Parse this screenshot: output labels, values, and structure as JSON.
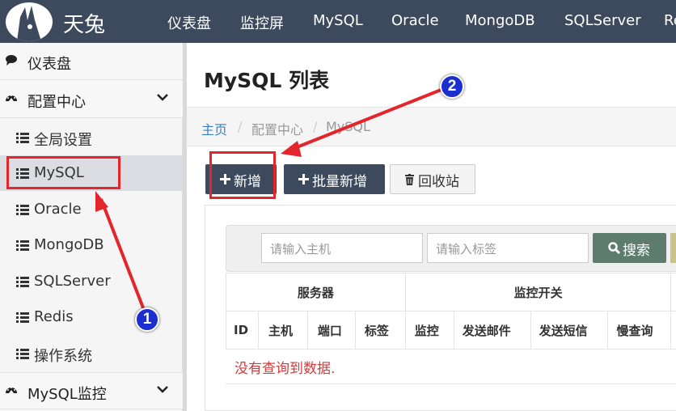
{
  "brand": {
    "name": "天兔"
  },
  "nav": [
    "仪表盘",
    "监控屏",
    "MySQL",
    "Oracle",
    "MongoDB",
    "SQLServer",
    "Re"
  ],
  "sidebar": {
    "dashboard": "仪表盘",
    "config_center": "配置中心",
    "items": [
      "全局设置",
      "MySQL",
      "Oracle",
      "MongoDB",
      "SQLServer",
      "Redis",
      "操作系统"
    ],
    "mysql_monitor": "MySQL监控",
    "active_item": "MySQL"
  },
  "page": {
    "title": "MySQL 列表"
  },
  "breadcrumb": {
    "home": "主页",
    "sep": "/",
    "section": "配置中心",
    "current": "MySQL"
  },
  "toolbar": {
    "add": "新增",
    "batch_add": "批量新增",
    "recycle": "回收站"
  },
  "search": {
    "host_placeholder": "请输入主机",
    "tag_placeholder": "请输入标签",
    "button": "搜索"
  },
  "table": {
    "group_headers": [
      "服务器",
      "监控开关"
    ],
    "columns": [
      "ID",
      "主机",
      "端口",
      "标签",
      "监控",
      "发送邮件",
      "发送短信",
      "慢查询"
    ],
    "empty_message": "没有查询到数据."
  },
  "annotations": {
    "badge_1": "1",
    "badge_2": "2"
  },
  "colors": {
    "topbar": "#3d4a5e",
    "primary_button": "#3d4a5e",
    "search_button": "#5d7b6f",
    "link": "#3b7fbf",
    "highlight": "#e3262c",
    "badge": "#1b2ecf",
    "empty_text": "#d43b3b"
  },
  "icons": {
    "dashboard": "comment-icon",
    "config": "dashboard-gauge-icon",
    "list": "list-icon",
    "add": "plus-icon",
    "recycle": "trash-icon",
    "search": "search-icon",
    "expand": "chevron-down-icon"
  }
}
